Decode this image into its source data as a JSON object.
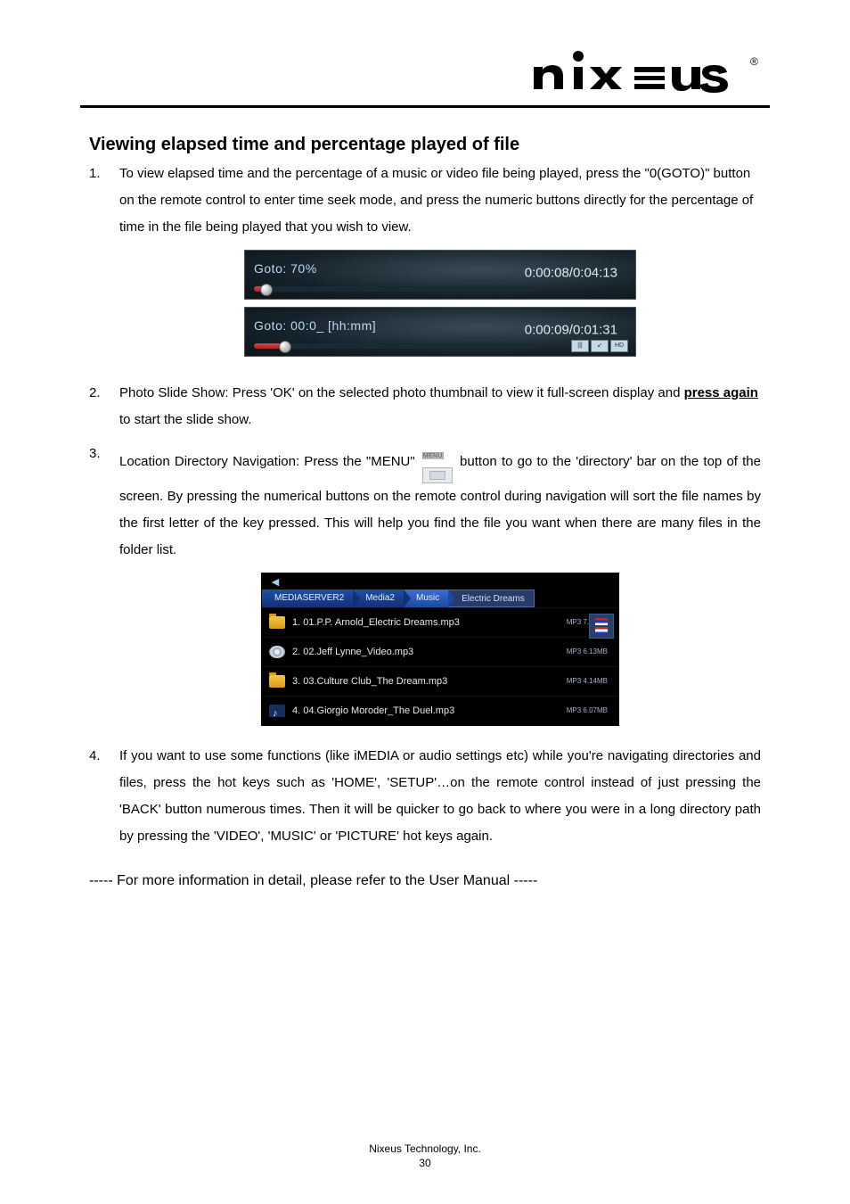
{
  "brand": {
    "name": "nixeus",
    "registered": "®"
  },
  "section_title": "Viewing elapsed time and percentage played of file",
  "items": {
    "i1": "To view elapsed time and the percentage of a music or video file being played, press the \"0(GOTO)\" button on the remote control to enter time seek mode, and press the numeric buttons directly for the percentage of time in the file being played that you wish to view.",
    "i2a": "Photo Slide Show: Press 'OK' on the selected photo thumbnail to view it full-screen display and ",
    "i2b": "press again",
    "i2c": " to start the slide show.",
    "i3a": "Location Directory Navigation: Press the \"MENU\" ",
    "i3b": " button to go to the 'directory' bar on the top of the screen. By pressing the numerical buttons on the remote control during navigation will sort the file names by the first letter of the key pressed. This will help you find the file you want when there are many files in the folder list.",
    "i4": "If you want to use some functions (like iMEDIA or audio settings etc) while you're navigating directories and files, press the hot keys such as 'HOME', 'SETUP'…on the remote control instead of just pressing the 'BACK' button numerous times. Then it will be quicker to go back to where you were in a long directory path by pressing the 'VIDEO', 'MUSIC' or 'PICTURE' hot keys again."
  },
  "menu_button_label": "MENU",
  "shot1": {
    "goto": "Goto: 70%",
    "time": "0:00:08/0:04:13",
    "fill_pct": 4
  },
  "shot2": {
    "goto": "Goto:  00:0_ [hh:mm]",
    "time": "0:00:09/0:01:31",
    "fill_pct": 11,
    "badges": [
      "|||",
      "↙",
      "HD"
    ]
  },
  "browser": {
    "crumbs": [
      "MEDIASERVER2",
      "Media2",
      "Music"
    ],
    "current": "Electric Dreams",
    "rows": [
      {
        "icon": "folder",
        "name": "1. 01.P.P. Arnold_Electric Dreams.mp3",
        "meta": "MP3   7.78MB"
      },
      {
        "icon": "disc",
        "name": "2. 02.Jeff Lynne_Video.mp3",
        "meta": "MP3   6.13MB"
      },
      {
        "icon": "folder",
        "name": "3. 03.Culture Club_The Dream.mp3",
        "meta": "MP3   4.14MB"
      },
      {
        "icon": "note",
        "name": "4. 04.Giorgio Moroder_The Duel.mp3",
        "meta": "MP3   6.07MB"
      }
    ]
  },
  "closing": "----- For more information in detail, please refer to the User Manual -----",
  "footer": {
    "company": "Nixeus Technology, Inc.",
    "page": "30"
  }
}
